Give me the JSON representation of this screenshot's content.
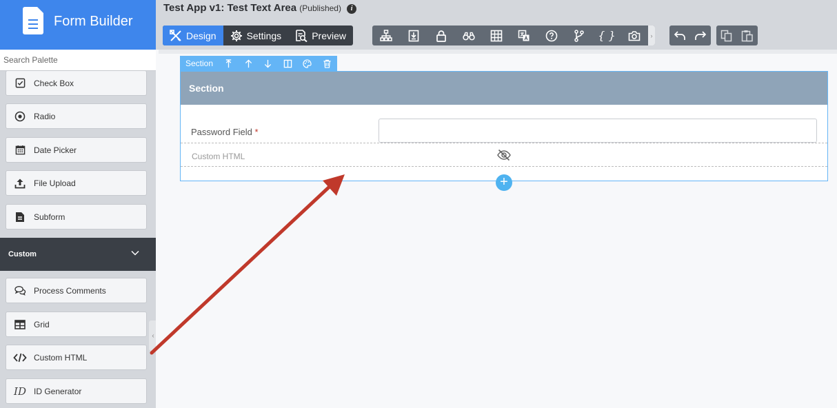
{
  "brand": {
    "title": "Form Builder",
    "icon": "document-icon",
    "color": "#3e86ec"
  },
  "palette": {
    "search_placeholder": "Search Palette",
    "items_top": [
      {
        "label": "Check Box",
        "icon": "checkbox-icon"
      },
      {
        "label": "Radio",
        "icon": "radio-icon"
      },
      {
        "label": "Date Picker",
        "icon": "calendar-icon"
      },
      {
        "label": "File Upload",
        "icon": "upload-icon"
      },
      {
        "label": "Subform",
        "icon": "subform-icon"
      }
    ],
    "group": {
      "label": "Custom",
      "icon": "chevron-down-icon"
    },
    "items_custom": [
      {
        "label": "Process Comments",
        "icon": "comments-icon"
      },
      {
        "label": "Grid",
        "icon": "table-icon"
      },
      {
        "label": "Custom HTML",
        "icon": "code-icon"
      },
      {
        "label": "ID Generator",
        "icon": "id-icon",
        "glyph": "ID"
      }
    ]
  },
  "header": {
    "title": "Test App v1: Test Text Area",
    "status": "(Published)",
    "tabs": [
      {
        "label": "Design",
        "icon": "design-tools-icon",
        "active": true
      },
      {
        "label": "Settings",
        "icon": "gear-icon"
      },
      {
        "label": "Preview",
        "icon": "preview-icon"
      }
    ],
    "tools": [
      "hierarchy-icon",
      "import-icon",
      "lock-icon",
      "binoculars-icon",
      "grid-icon",
      "translate-icon",
      "help-icon",
      "branch-icon",
      "braces-icon",
      "camera-icon"
    ],
    "history_tools": [
      "undo-icon",
      "redo-icon"
    ],
    "clipboard_tools": [
      "copy-icon",
      "paste-icon"
    ],
    "braces_glyph": "{ }"
  },
  "canvas": {
    "section_toolbar": {
      "label": "Section",
      "buttons": [
        "move-icon",
        "arrow-up-icon",
        "arrow-down-icon",
        "columns-icon",
        "palette-icon",
        "trash-icon"
      ]
    },
    "section_title": "Section",
    "field": {
      "label": "Password Field",
      "required_mark": "*",
      "value": ""
    },
    "html_component": {
      "label": "Custom HTML",
      "icon": "eye-slash-icon"
    },
    "add_symbol": "+"
  },
  "colors": {
    "accent": "#3e86ec",
    "selection": "#64b5f6",
    "sidebar": "#d4d7dc",
    "dark": "#3a3f46",
    "arrow": "#c0392b"
  }
}
